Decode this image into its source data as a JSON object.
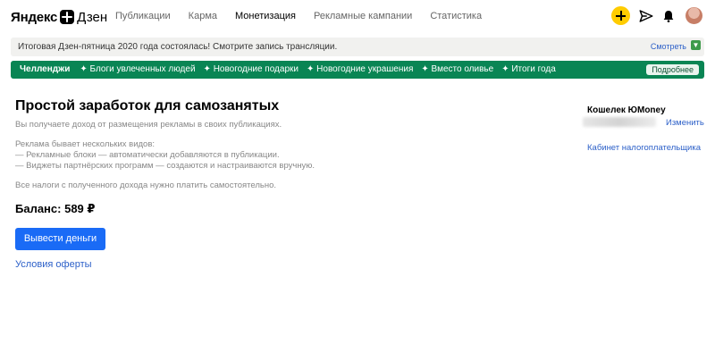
{
  "header": {
    "logo_word1": "Яндекс",
    "logo_word2": "Дзен",
    "nav": [
      {
        "label": "Публикации"
      },
      {
        "label": "Карма"
      },
      {
        "label": "Монетизация"
      },
      {
        "label": "Рекламные кампании"
      },
      {
        "label": "Статистика"
      }
    ],
    "icons": [
      "plus-icon",
      "send-icon",
      "bell-icon",
      "avatar"
    ],
    "accent_color": "#ffcc00"
  },
  "notice": {
    "text": "Итоговая Дзен-пятница 2020 года состоялась! Смотрите запись трансляции.",
    "link": "Смотреть"
  },
  "challenges": {
    "title": "Челленджи",
    "items": [
      "Блоги увлеченных людей",
      "Новогодние подарки",
      "Новогодние украшения",
      "Вместо оливье",
      "Итоги года"
    ],
    "more_label": "Подробнее",
    "bg_color": "#098554"
  },
  "main": {
    "title": "Простой заработок для самозанятых",
    "intro": "Вы получаете доход от размещения рекламы в своих публикациях.",
    "ads_line1": "Реклама бывает нескольких видов:",
    "ads_line2": "— Рекламные блоки — автоматически добавляются в публикации.",
    "ads_line3": "— Виджеты партнёрских программ — создаются и настраиваются вручную.",
    "tax_note": "Все налоги с полученного дохода нужно платить самостоятельно.",
    "balance_label": "Баланс: 589 ₽",
    "withdraw_button": "Вывести деньги",
    "terms_link": "Условия оферты",
    "button_color": "#1a6bf6"
  },
  "sidebar": {
    "wallet_title": "Кошелек ЮMoney",
    "change_link": "Изменить",
    "tax_cabinet_link": "Кабинет налогоплательщика"
  }
}
